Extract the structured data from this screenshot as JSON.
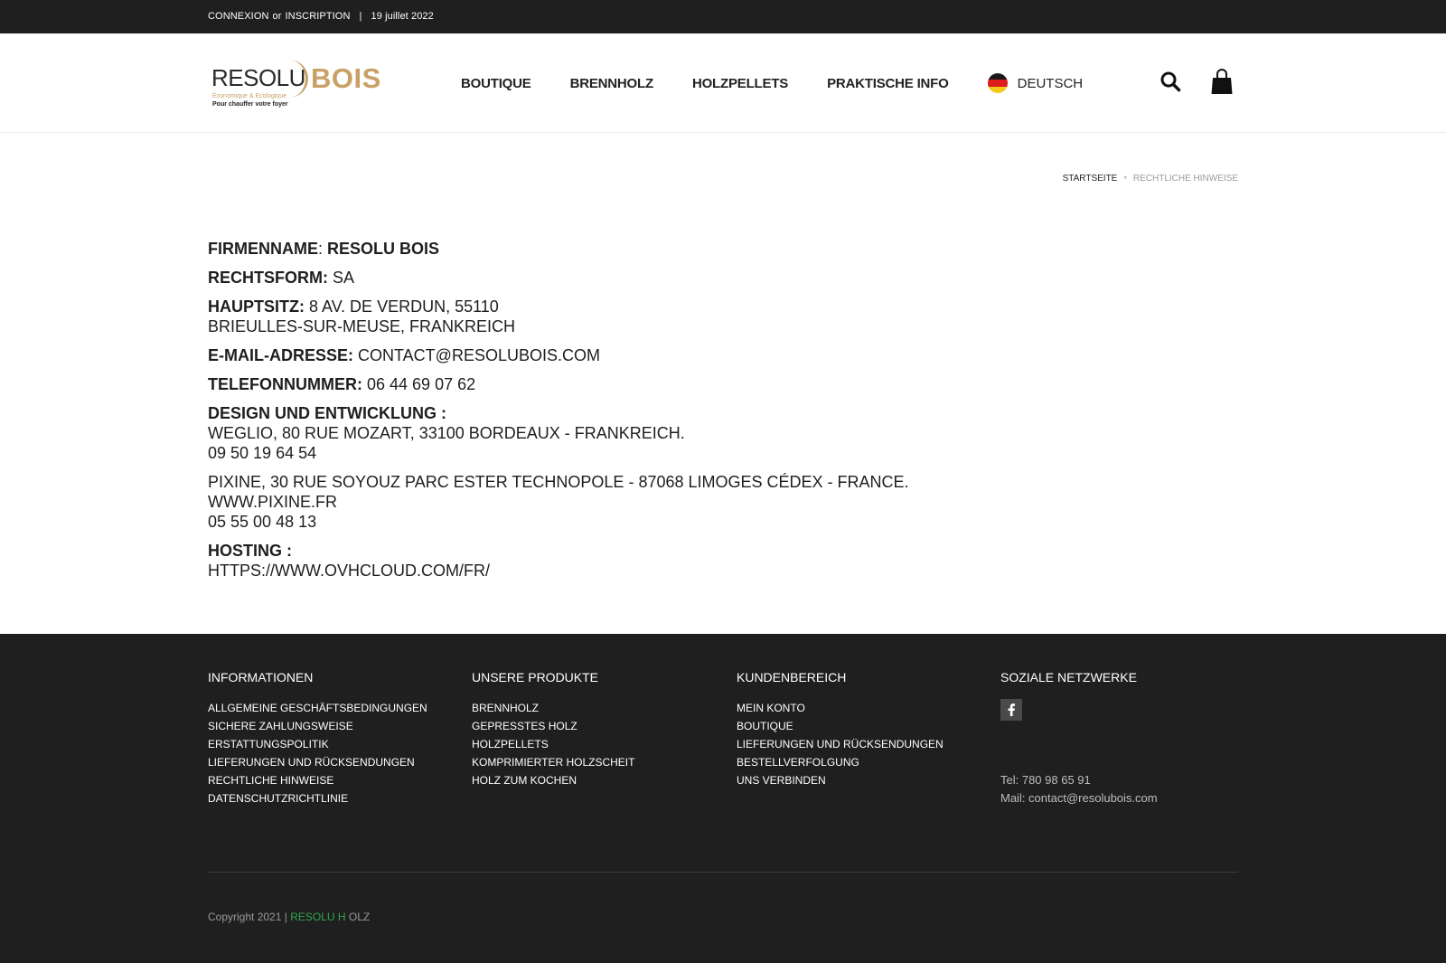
{
  "topbar": {
    "login": "CONNEXION",
    "or": "or",
    "register": "INSCRIPTION",
    "separator": "|",
    "date": "19 juillet 2022"
  },
  "logo": {
    "text_resolu": "RESOLU",
    "text_bois": "BOIS",
    "tagline1": "Economique & Ecologique",
    "tagline2": "Pour chauffer votre foyer",
    "colors": {
      "gold": "#c9a066",
      "dark": "#2b2b2b"
    }
  },
  "nav": {
    "items": [
      {
        "label": "BOUTIQUE"
      },
      {
        "label": "BRENNHOLZ"
      },
      {
        "label": "HOLZPELLETS"
      },
      {
        "label": "PRAKTISCHE INFO"
      }
    ],
    "language": {
      "label": "DEUTSCH",
      "flag_icon": "germany-flag-icon"
    },
    "search_icon": "search-icon",
    "cart_icon": "shopping-bag-icon"
  },
  "breadcrumb": {
    "home": "STARTSEITE",
    "separator": "*",
    "current": "RECHTLICHE HINWEISE"
  },
  "legal": {
    "company_label": "FIRMENNAME",
    "company_colon": ":",
    "company_value": "RESOLU BOIS",
    "form_label": "RECHTSFORM:",
    "form_value": "SA",
    "seat_label": "HAUPTSITZ:",
    "seat_line1": "8 AV. DE VERDUN, 55110",
    "seat_line2": "BRIEULLES-SUR-MEUSE, FRANKREICH",
    "email_label": "E-MAIL-ADRESSE:",
    "email_value": "CONTACT@RESOLUBOIS.COM",
    "phone_label": "TELEFONNUMMER:",
    "phone_value": "06 44 69 07 62",
    "design_label": "DESIGN UND ENTWICKLUNG :",
    "design_line1": "WEGLIO, 80 RUE MOZART, 33100 BORDEAUX - FRANKREICH.",
    "design_line2": "09 50 19 64 54",
    "pixine_line1": "PIXINE, 30 RUE SOYOUZ PARC ESTER TECHNOPOLE - 87068 LIMOGES CÉDEX - FRANCE.",
    "pixine_line2": "WWW.PIXINE.FR",
    "pixine_line3": "05 55 00 48 13",
    "hosting_label": "HOSTING :",
    "hosting_value": "HTTPS://WWW.OVHCLOUD.COM/FR/"
  },
  "footer": {
    "col1": {
      "title": "INFORMATIONEN",
      "links": [
        "ALLGEMEINE GESCHÄFTSBEDINGUNGEN",
        "SICHERE ZAHLUNGSWEISE",
        "ERSTATTUNGSPOLITIK",
        "LIEFERUNGEN UND RÜCKSENDUNGEN",
        "RECHTLICHE HINWEISE",
        "DATENSCHUTZRICHTLINIE"
      ]
    },
    "col2": {
      "title": "UNSERE PRODUKTE",
      "links": [
        "BRENNHOLZ",
        "GEPRESSTES HOLZ",
        "HOLZPELLETS",
        "KOMPRIMIERTER HOLZSCHEIT",
        "HOLZ ZUM KOCHEN"
      ]
    },
    "col3": {
      "title": "KUNDENBEREICH",
      "links": [
        "MEIN KONTO",
        "BOUTIQUE",
        "LIEFERUNGEN UND RÜCKSENDUNGEN",
        "BESTELLVERFOLGUNG",
        "UNS VERBINDEN"
      ]
    },
    "col4": {
      "title": "SOZIALE NETZWERKE",
      "facebook_icon": "facebook-icon",
      "tel": "Tel: 780 98 65 91",
      "mail": "Mail: contact@resolubois.com"
    },
    "copyright_prefix": "Copyright 2021 |",
    "copyright_brand": "RESOLU H",
    "copyright_suffix": "OLZ",
    "colors": {
      "background": "#1f1f1f",
      "brand_green": "#2fa64f"
    }
  }
}
